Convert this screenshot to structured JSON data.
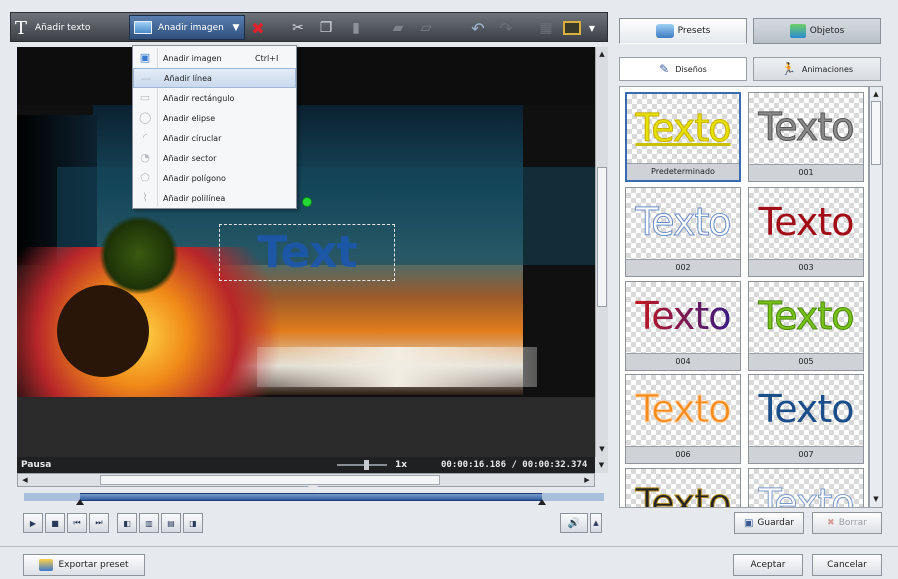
{
  "toolbar": {
    "add_text": "Añadir texto",
    "add_image": "Anadir imagen"
  },
  "menu": {
    "items": [
      {
        "label": "Anadir imagen",
        "shortcut": "Ctrl+I"
      },
      {
        "label": "Añadir línea",
        "shortcut": ""
      },
      {
        "label": "Añadir rectángulo",
        "shortcut": ""
      },
      {
        "label": "Anadir elipse",
        "shortcut": ""
      },
      {
        "label": "Añadir círuclar",
        "shortcut": ""
      },
      {
        "label": "Añadir sector",
        "shortcut": ""
      },
      {
        "label": "Añadir polígono",
        "shortcut": ""
      },
      {
        "label": "Añadir polilínea",
        "shortcut": ""
      }
    ],
    "highlighted_index": 1
  },
  "preview": {
    "overlay_text": "Text"
  },
  "status": {
    "state": "Pausa",
    "speed": "1x",
    "time": "00:00:16.186 / 00:00:32.374"
  },
  "right_tabs": {
    "presets": "Presets",
    "objects": "Objetos"
  },
  "sub_tabs": {
    "designs": "Diseños",
    "animations": "Animaciones"
  },
  "presets": [
    {
      "text": "Texto",
      "label": "Predeterminado",
      "color": "#e6e200"
    },
    {
      "text": "Texto",
      "label": "001",
      "color": "#8a8a8a"
    },
    {
      "text": "Texto",
      "label": "002",
      "color": "#ffffff"
    },
    {
      "text": "Texto",
      "label": "003",
      "color": "#a10e18"
    },
    {
      "text": "Texto",
      "label": "004",
      "color": "#2a1a6a"
    },
    {
      "text": "Texto",
      "label": "005",
      "color": "#78c21a"
    },
    {
      "text": "Texto",
      "label": "006",
      "color": "#f38a1a"
    },
    {
      "text": "Texto",
      "label": "007",
      "color": "#1c4f8a"
    },
    {
      "text": "Texto",
      "label": "",
      "color": "#222222"
    },
    {
      "text": "Texto",
      "label": "",
      "color": "#ffffff"
    }
  ],
  "buttons": {
    "save": "Guardar",
    "delete": "Borrar",
    "export": "Exportar preset",
    "accept": "Aceptar",
    "cancel": "Cancelar"
  }
}
